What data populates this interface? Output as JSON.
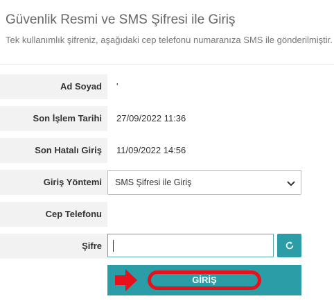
{
  "header": {
    "title": "Güvenlik Resmi ve SMS Şifresi ile Giriş",
    "subtitle": "Tek kullanımlık şifreniz, aşağıdaki cep telefonu numaranıza SMS ile gönderilmiştir."
  },
  "form": {
    "name_label": "Ad Soyad",
    "name_value": "'",
    "last_transaction_label": "Son İşlem Tarihi",
    "last_transaction_value": "27/09/2022 11:36",
    "last_failed_label": "Son Hatalı Giriş",
    "last_failed_value": "11/09/2022 14:56",
    "method_label": "Giriş Yöntemi",
    "method_selected": "SMS Şifresi ile Giriş",
    "phone_label": "Cep Telefonu",
    "phone_value": "",
    "password_label": "Şifre",
    "password_value": ""
  },
  "actions": {
    "login_label": "GİRİŞ",
    "refresh_icon": "refresh-icon"
  },
  "colors": {
    "accent": "#2a9da6",
    "highlight": "#e8101b",
    "label_bg": "#f2f2f2"
  }
}
